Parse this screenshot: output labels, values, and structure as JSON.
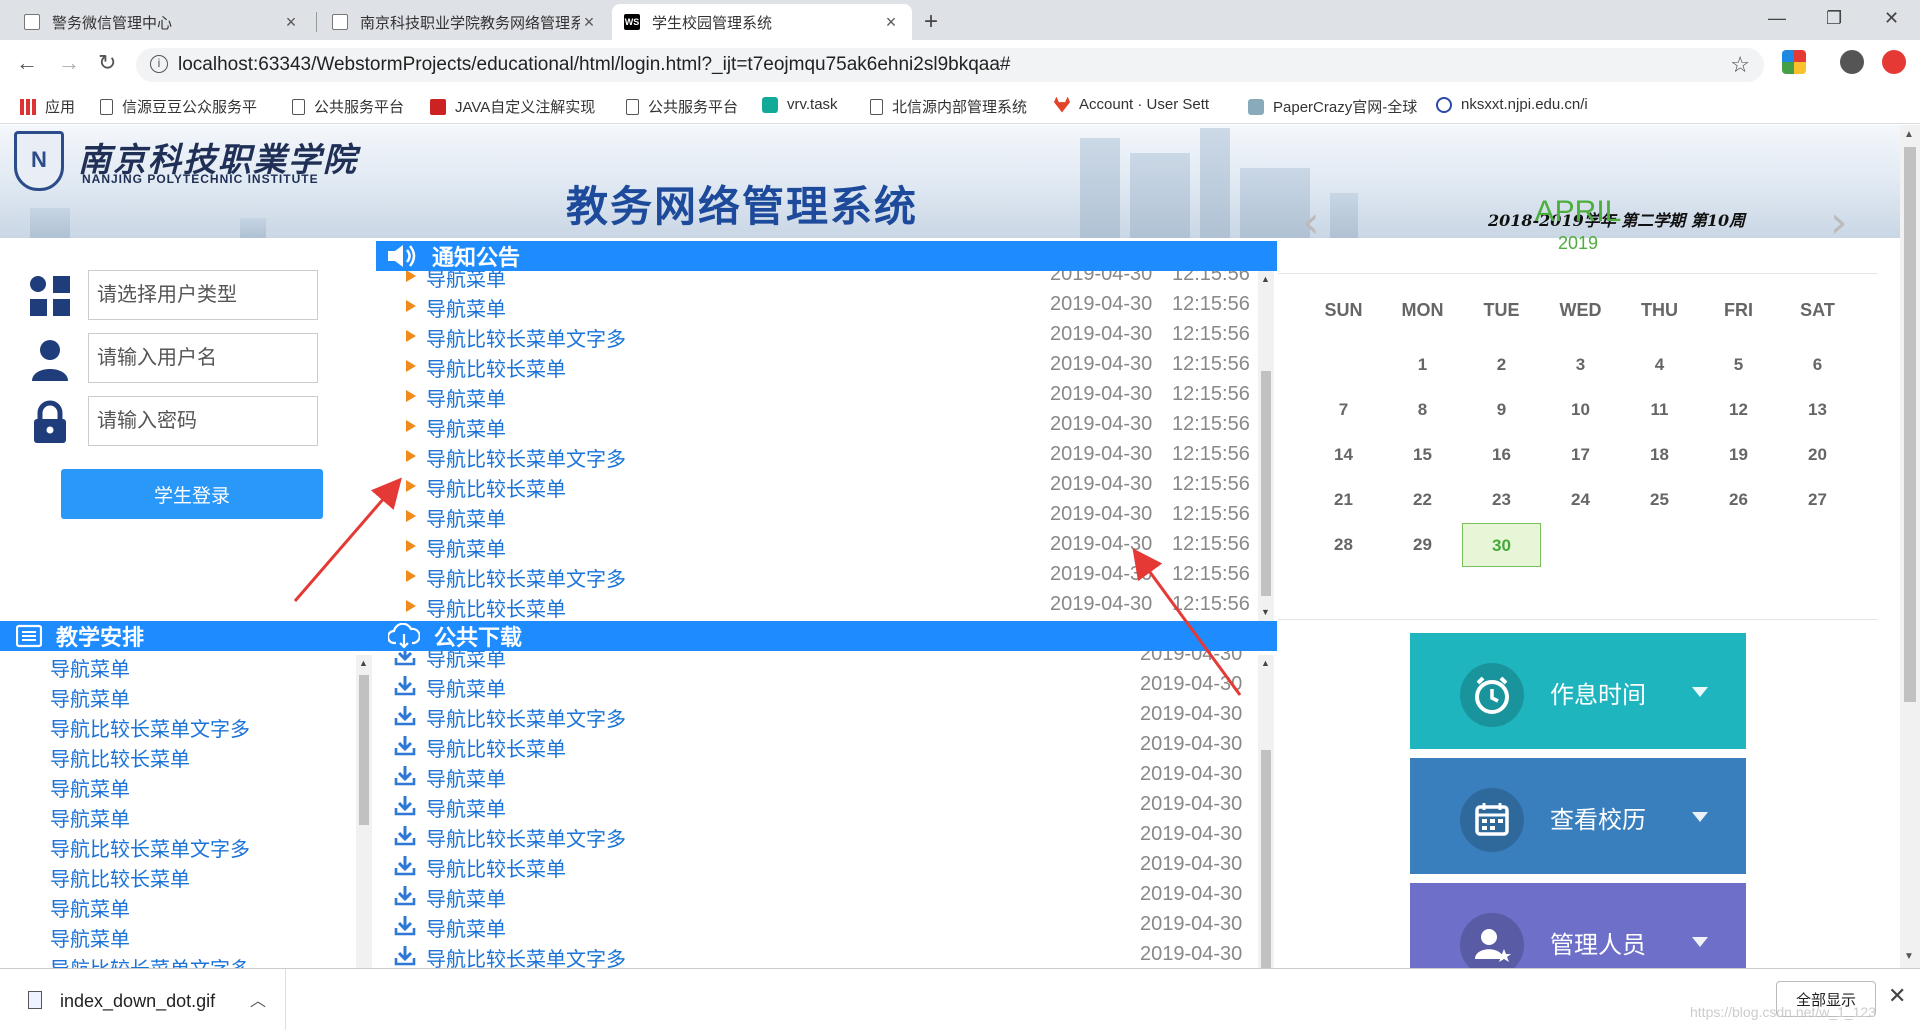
{
  "browser": {
    "tabs": [
      {
        "title": "警务微信管理中心",
        "active": false
      },
      {
        "title": "南京科技职业学院教务网络管理系",
        "active": false
      },
      {
        "title": "学生校园管理系统",
        "active": true
      }
    ],
    "url": "localhost:63343/WebstormProjects/educational/html/login.html?_ijt=t7eojmqu75ak6ehni2sl9bkqaa#",
    "bookmarks": [
      "应用",
      "信源豆豆公众服务平",
      "公共服务平台",
      "JAVA自定义注解实现",
      "公共服务平台",
      "vrv.task",
      "北信源内部管理系统",
      "Account · User Sett",
      "PaperCrazy官网-全球",
      "nksxxt.njpi.edu.cn/i"
    ]
  },
  "header": {
    "logo_cn": "南京科技职業学院",
    "logo_en": "NANJING POLYTECHNIC INSTITUTE",
    "system_title": "教务网络管理系统",
    "term": "2018-2019学年 第二学期  第10周"
  },
  "login": {
    "user_type_placeholder": "请选择用户类型",
    "username_placeholder": "请输入用户名",
    "password_placeholder": "请输入密码",
    "button": "学生登录"
  },
  "notices": {
    "title": "通知公告",
    "items": [
      {
        "label": "导航菜单",
        "date": "2019-04-30",
        "time": "12:15:56"
      },
      {
        "label": "导航菜单",
        "date": "2019-04-30",
        "time": "12:15:56"
      },
      {
        "label": "导航比较长菜单文字多",
        "date": "2019-04-30",
        "time": "12:15:56"
      },
      {
        "label": "导航比较长菜单",
        "date": "2019-04-30",
        "time": "12:15:56"
      },
      {
        "label": "导航菜单",
        "date": "2019-04-30",
        "time": "12:15:56"
      },
      {
        "label": "导航菜单",
        "date": "2019-04-30",
        "time": "12:15:56"
      },
      {
        "label": "导航比较长菜单文字多",
        "date": "2019-04-30",
        "time": "12:15:56"
      },
      {
        "label": "导航比较长菜单",
        "date": "2019-04-30",
        "time": "12:15:56"
      },
      {
        "label": "导航菜单",
        "date": "2019-04-30",
        "time": "12:15:56"
      },
      {
        "label": "导航菜单",
        "date": "2019-04-30",
        "time": "12:15:56"
      },
      {
        "label": "导航比较长菜单文字多",
        "date": "2019-04-30",
        "time": "12:15:56"
      },
      {
        "label": "导航比较长菜单",
        "date": "2019-04-30",
        "time": "12:15:56"
      }
    ]
  },
  "teaching": {
    "title": "教学安排",
    "items": [
      "导航菜单",
      "导航菜单",
      "导航比较长菜单文字多",
      "导航比较长菜单",
      "导航菜单",
      "导航菜单",
      "导航比较长菜单文字多",
      "导航比较长菜单",
      "导航菜单",
      "导航菜单",
      "导航比较长菜单文字多"
    ]
  },
  "downloads": {
    "title": "公共下载",
    "items": [
      {
        "label": "导航菜单",
        "date": "2019-04-30"
      },
      {
        "label": "导航菜单",
        "date": "2019-04-30"
      },
      {
        "label": "导航比较长菜单文字多",
        "date": "2019-04-30"
      },
      {
        "label": "导航比较长菜单",
        "date": "2019-04-30"
      },
      {
        "label": "导航菜单",
        "date": "2019-04-30"
      },
      {
        "label": "导航菜单",
        "date": "2019-04-30"
      },
      {
        "label": "导航比较长菜单文字多",
        "date": "2019-04-30"
      },
      {
        "label": "导航比较长菜单",
        "date": "2019-04-30"
      },
      {
        "label": "导航菜单",
        "date": "2019-04-30"
      },
      {
        "label": "导航菜单",
        "date": "2019-04-30"
      },
      {
        "label": "导航比较长菜单文字多",
        "date": "2019-04-30"
      }
    ]
  },
  "calendar": {
    "month": "APRIL",
    "year": "2019",
    "weekdays": [
      "SUN",
      "MON",
      "TUE",
      "WED",
      "THU",
      "FRI",
      "SAT"
    ],
    "first_weekday": 1,
    "days_in_month": 30,
    "today": 30
  },
  "tiles": [
    {
      "label": "作息时间",
      "color": "#1fb5bf",
      "icon": "clock-icon"
    },
    {
      "label": "查看校历",
      "color": "#3a7fbd",
      "icon": "calendar-icon"
    },
    {
      "label": "管理人员",
      "color": "#6d6fc9",
      "icon": "user-star-icon"
    }
  ],
  "download_bar": {
    "file": "index_down_dot.gif",
    "show_all": "全部显示"
  },
  "watermark": "https://blog.csdn.net/w_1_123",
  "colors": {
    "accent": "#1e8cff",
    "link": "#1a73d9",
    "arrow": "#e53935"
  }
}
